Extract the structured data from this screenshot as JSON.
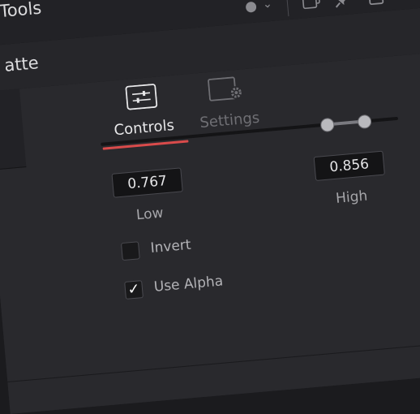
{
  "header": {
    "tools_title": "Tools",
    "icons": [
      "color-dot-icon",
      "chevron-down-icon",
      "cascade-windows-icon",
      "pin-icon",
      "lock-icon"
    ]
  },
  "node": {
    "title": "atte"
  },
  "tabs": [
    {
      "label": "Controls",
      "icon": "sliders-icon",
      "active": true
    },
    {
      "label": "Settings",
      "icon": "settings-gear-icon",
      "active": false
    }
  ],
  "range": {
    "low_value": "0.767",
    "high_value": "0.856",
    "low_label": "Low",
    "high_label": "High"
  },
  "options": {
    "invert_label": "Invert",
    "invert_checked": false,
    "use_alpha_label": "Use Alpha",
    "use_alpha_checked": true
  },
  "colors": {
    "accent_underline": "#d94b4b",
    "panel_bg": "#29292d",
    "text_primary": "#e8e8ea",
    "text_muted": "#6f6f74"
  }
}
